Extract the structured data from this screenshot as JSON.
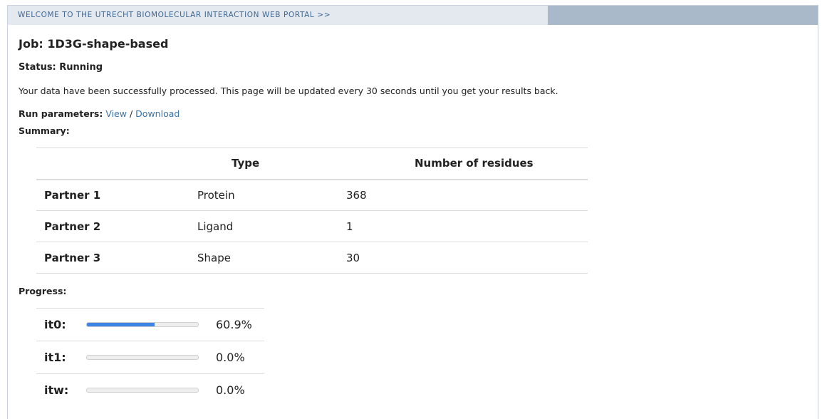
{
  "header": {
    "portal_link": "WELCOME TO THE UTRECHT BIOMOLECULAR INTERACTION WEB PORTAL >>"
  },
  "job": {
    "title": "Job: 1D3G-shape-based",
    "status": "Status: Running",
    "message": "Your data have been successfully processed. This page will be updated every 30 seconds until you get your results back."
  },
  "run_params": {
    "label": "Run parameters:",
    "view": "View",
    "separator": "/",
    "download": "Download"
  },
  "summary": {
    "label": "Summary:",
    "headers": [
      "",
      "Type",
      "Number of residues"
    ],
    "rows": [
      {
        "partner": "Partner 1",
        "type": "Protein",
        "residues": "368"
      },
      {
        "partner": "Partner 2",
        "type": "Ligand",
        "residues": "1"
      },
      {
        "partner": "Partner 3",
        "type": "Shape",
        "residues": "30"
      }
    ]
  },
  "progress": {
    "label": "Progress:",
    "bar_color": "#3d84e3",
    "rows": [
      {
        "name": "it0:",
        "percent_text": "60.9%",
        "fraction": 0.609
      },
      {
        "name": "it1:",
        "percent_text": "0.0%",
        "fraction": 0.0
      },
      {
        "name": "itw:",
        "percent_text": "0.0%",
        "fraction": 0.0
      }
    ]
  }
}
